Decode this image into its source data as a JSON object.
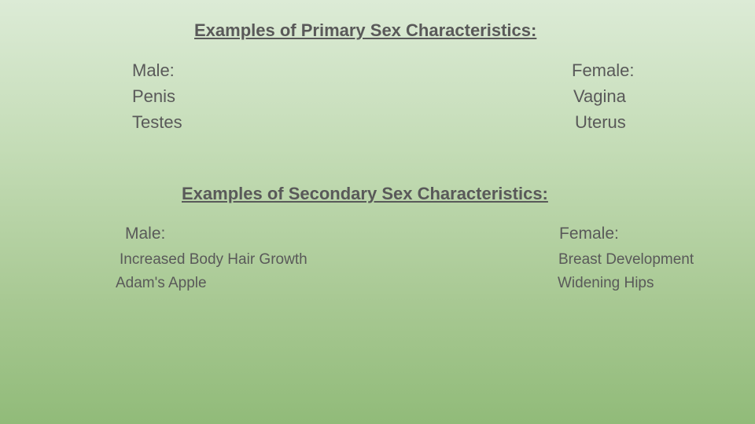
{
  "primary": {
    "heading": "Examples of Primary Sex Characteristics:",
    "male": {
      "label": "Male:",
      "items": [
        "Penis",
        "Testes"
      ]
    },
    "female": {
      "label": "Female:",
      "items": [
        "Vagina",
        "Uterus"
      ]
    }
  },
  "secondary": {
    "heading": "Examples of Secondary Sex Characteristics:",
    "male": {
      "label": "Male:",
      "items": [
        "Increased Body Hair Growth",
        "Adam's Apple"
      ]
    },
    "female": {
      "label": "Female:",
      "items": [
        "Breast Development",
        "Widening Hips"
      ]
    }
  }
}
